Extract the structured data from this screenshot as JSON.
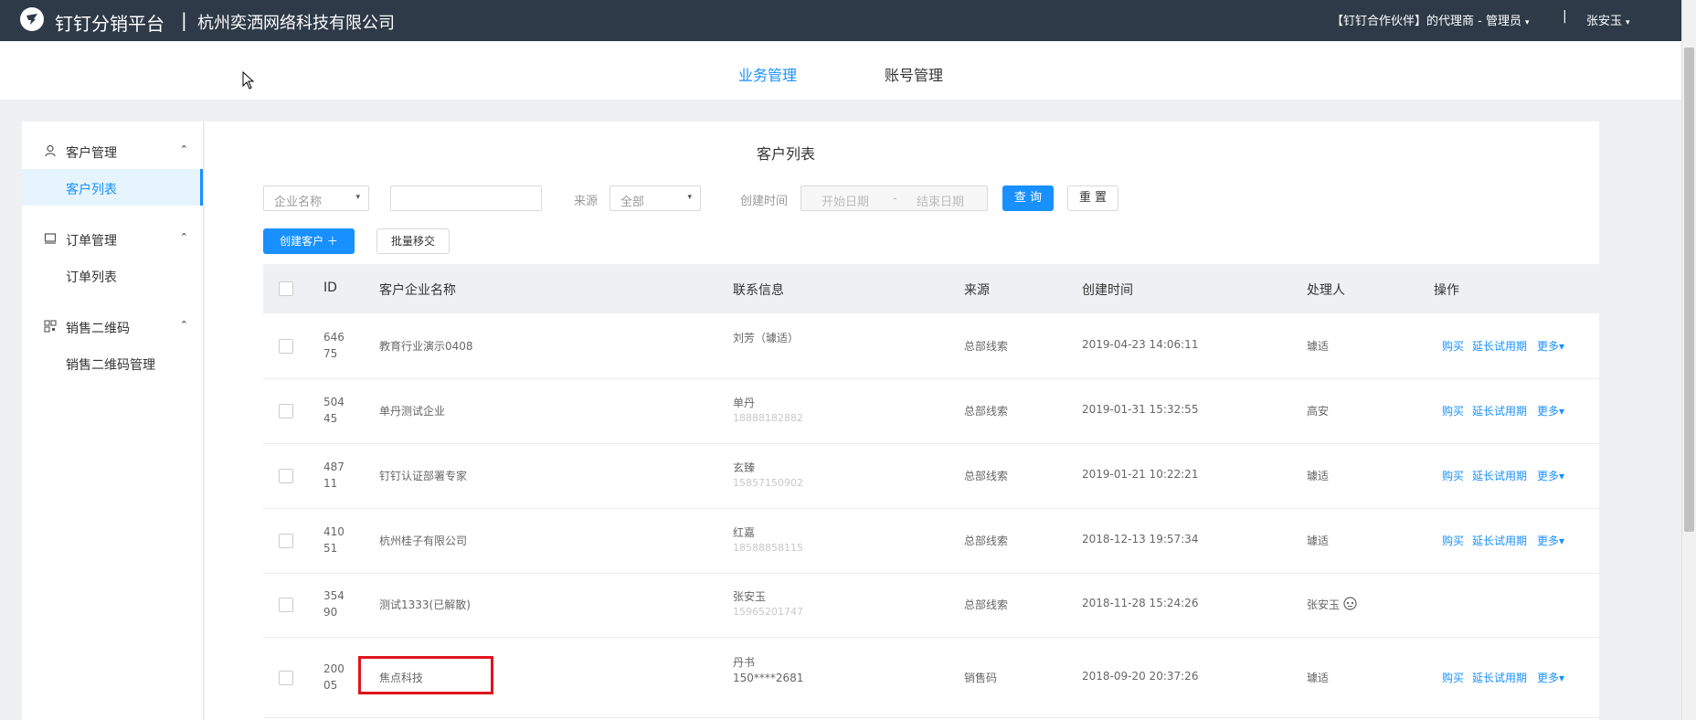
{
  "header": {
    "brand": "钉钉分销平台",
    "separator": "|",
    "company": "杭州奕洒网络科技有限公司",
    "agent_role": "【钉钉合作伙伴】的代理商 - 管理员",
    "top_separator": "|",
    "user": "张安玉",
    "caret": "▾"
  },
  "nav": {
    "business": "业务管理",
    "account": "账号管理"
  },
  "sidebar": {
    "groups": [
      {
        "label": "客户管理",
        "arrow": "⌃",
        "items": [
          {
            "label": "客户列表"
          }
        ]
      },
      {
        "label": "订单管理",
        "arrow": "⌃",
        "items": [
          {
            "label": "订单列表"
          }
        ]
      },
      {
        "label": "销售二维码",
        "arrow": "⌃",
        "items": [
          {
            "label": "销售二维码管理"
          }
        ]
      }
    ]
  },
  "page": {
    "title": "客户列表"
  },
  "filters": {
    "field_select": "企业名称",
    "keyword_value": "",
    "source_label": "来源",
    "source_value": "全部",
    "created_label": "创建时间",
    "start_placeholder": "开始日期",
    "dash": "-",
    "end_placeholder": "结束日期",
    "query_button": "查 询",
    "reset_button": "重 置",
    "arrow": "▾"
  },
  "actions": {
    "create_customer": "创建客户 ＋",
    "batch_transfer": "批量移交"
  },
  "table": {
    "columns": [
      "ID",
      "客户企业名称",
      "联系信息",
      "来源",
      "创建时间",
      "处理人",
      "操作"
    ],
    "rows": [
      {
        "id1": "646",
        "id2": "75",
        "name": "教育行业演示0408",
        "contact": "刘芳（璩适）",
        "contact2": "",
        "source": "总部线索",
        "created": "2019-04-23 14:06:11",
        "handler": "璩适",
        "ops": [
          "购买",
          "延长试用期",
          "更多▾"
        ]
      },
      {
        "id1": "504",
        "id2": "45",
        "name": "单丹测试企业",
        "contact": "单丹",
        "contact2": "18888182882",
        "source": "总部线索",
        "created": "2019-01-31 15:32:55",
        "handler": "高安",
        "ops": [
          "购买",
          "延长试用期",
          "更多▾"
        ]
      },
      {
        "id1": "487",
        "id2": "11",
        "name": "钉钉认证部署专家",
        "contact": "玄臻",
        "contact2": "15857150902",
        "source": "总部线索",
        "created": "2019-01-21 10:22:21",
        "handler": "璩适",
        "ops": [
          "购买",
          "延长试用期",
          "更多▾"
        ]
      },
      {
        "id1": "410",
        "id2": "51",
        "name": "杭州桂子有限公司",
        "contact": "红嘉",
        "contact2": "18588858115",
        "source": "总部线索",
        "created": "2018-12-13 19:57:34",
        "handler": "璩适",
        "ops": [
          "购买",
          "延长试用期",
          "更多▾"
        ]
      },
      {
        "id1": "354",
        "id2": "90",
        "name": "测试1333(已解散)",
        "contact": "张安玉",
        "contact2": "15965201747",
        "source": "总部线索",
        "created": "2018-11-28 15:24:26",
        "handler": "张安玉",
        "ops": []
      },
      {
        "id1": "200",
        "id2": "05",
        "name": "焦点科技",
        "contact": "丹书",
        "contact2": "150****2681",
        "source": "销售码",
        "created": "2018-09-20 20:37:26",
        "handler": "璩适",
        "ops": [
          "购买",
          "延长试用期",
          "更多▾"
        ]
      }
    ]
  },
  "colors": {
    "topbar": "#2e3a47",
    "accent": "#1890ff",
    "highlight_box": "#e0141e"
  },
  "icons": [
    "dingtalk-logo-icon",
    "user-icon",
    "monitor-icon",
    "qrcode-icon",
    "cursor-icon",
    "robot-icon"
  ]
}
